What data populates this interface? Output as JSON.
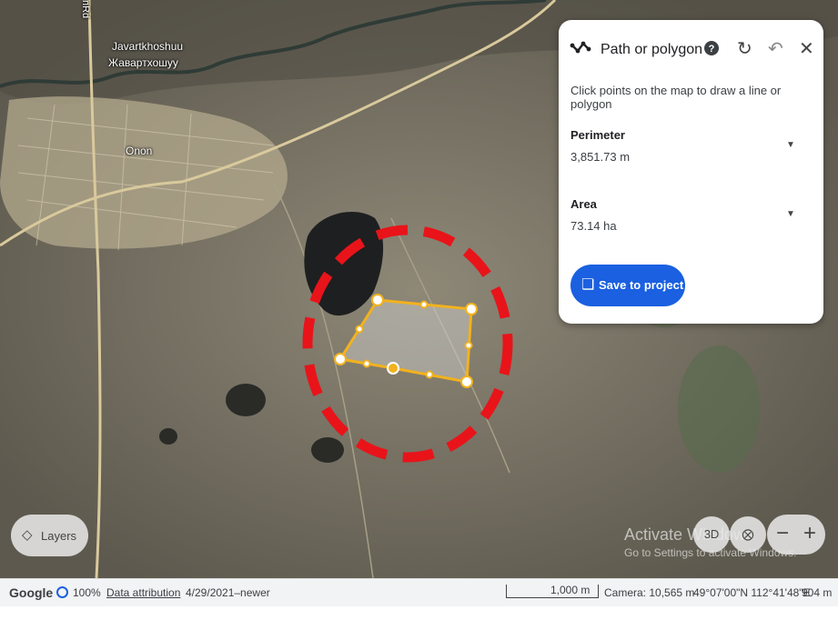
{
  "map": {
    "place_name_latin": "Javartkhoshuu",
    "place_name_cyrillic": "Жавартхошуу",
    "town_label": "Onon",
    "road_label": "nRd",
    "polygon_color": "#f2b21e",
    "highlight_circle_color": "#e8141a"
  },
  "panel": {
    "title": "Path or polygon",
    "path_icon": "path-icon",
    "help_icon": "help-icon",
    "redo_icon": "redo-icon",
    "undo_icon": "undo-icon",
    "close_icon": "close-icon",
    "hint": "Click points on the map to draw a line or polygon",
    "perimeter_label": "Perimeter",
    "perimeter_value": "3,851.73 m",
    "area_label": "Area",
    "area_value": "73.14 ha",
    "save_label": "Save to project",
    "save_color": "#1a60e0"
  },
  "controls": {
    "layers_label": "Layers",
    "three_d_label": "3D",
    "zoom_out": "−",
    "zoom_in": "+"
  },
  "watermark": {
    "line1": "Activate Windows",
    "line2": "Go to Settings to activate Windows."
  },
  "bottom_bar": {
    "brand": "Google",
    "load_percent": "100%",
    "attribution": "Data attribution",
    "imagery_date": "4/29/2021–newer",
    "scale_label": "1,000 m",
    "camera": "Camera: 10,565 m",
    "coordinates": "49°07'00\"N 112°41'48\"E",
    "elevation": "904 m"
  }
}
